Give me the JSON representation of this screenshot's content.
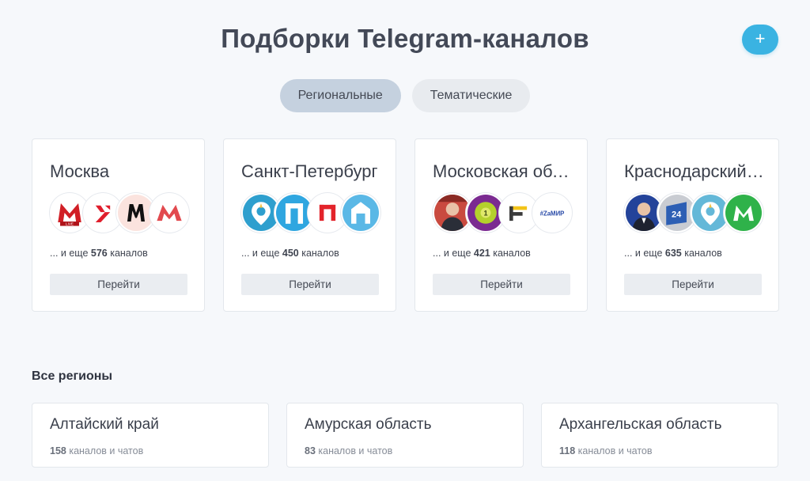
{
  "header": {
    "title": "Подборки Telegram-каналов",
    "add_button": "+"
  },
  "tabs": [
    {
      "label": "Региональные",
      "active": true
    },
    {
      "label": "Тематические",
      "active": false
    }
  ],
  "featured": [
    {
      "title": "Москва",
      "prefix": "... и еще ",
      "count": "576",
      "suffix": " каналов",
      "button": "Перейти"
    },
    {
      "title": "Санкт-Петербург",
      "prefix": "... и еще ",
      "count": "450",
      "suffix": " каналов",
      "button": "Перейти"
    },
    {
      "title": "Московская область",
      "prefix": "... и еще ",
      "count": "421",
      "suffix": " каналов",
      "button": "Перейти"
    },
    {
      "title": "Краснодарский край",
      "prefix": "... и еще ",
      "count": "635",
      "suffix": " каналов",
      "button": "Перейти"
    }
  ],
  "avatar_texts": {
    "live": "LIVE",
    "one": "1",
    "zamir": "#ZaМИР",
    "n24": "24"
  },
  "all_regions": {
    "title": "Все регионы",
    "items": [
      {
        "name": "Алтайский край",
        "count": "158",
        "suffix": " каналов и чатов"
      },
      {
        "name": "Амурская область",
        "count": "83",
        "suffix": " каналов и чатов"
      },
      {
        "name": "Архангельская область",
        "count": "118",
        "suffix": " каналов и чатов"
      }
    ]
  },
  "colors": {
    "accent": "#3ab3e2",
    "tab_active": "#c5d1df",
    "tab_inactive": "#e8ebef",
    "background": "#f6f8fb"
  }
}
